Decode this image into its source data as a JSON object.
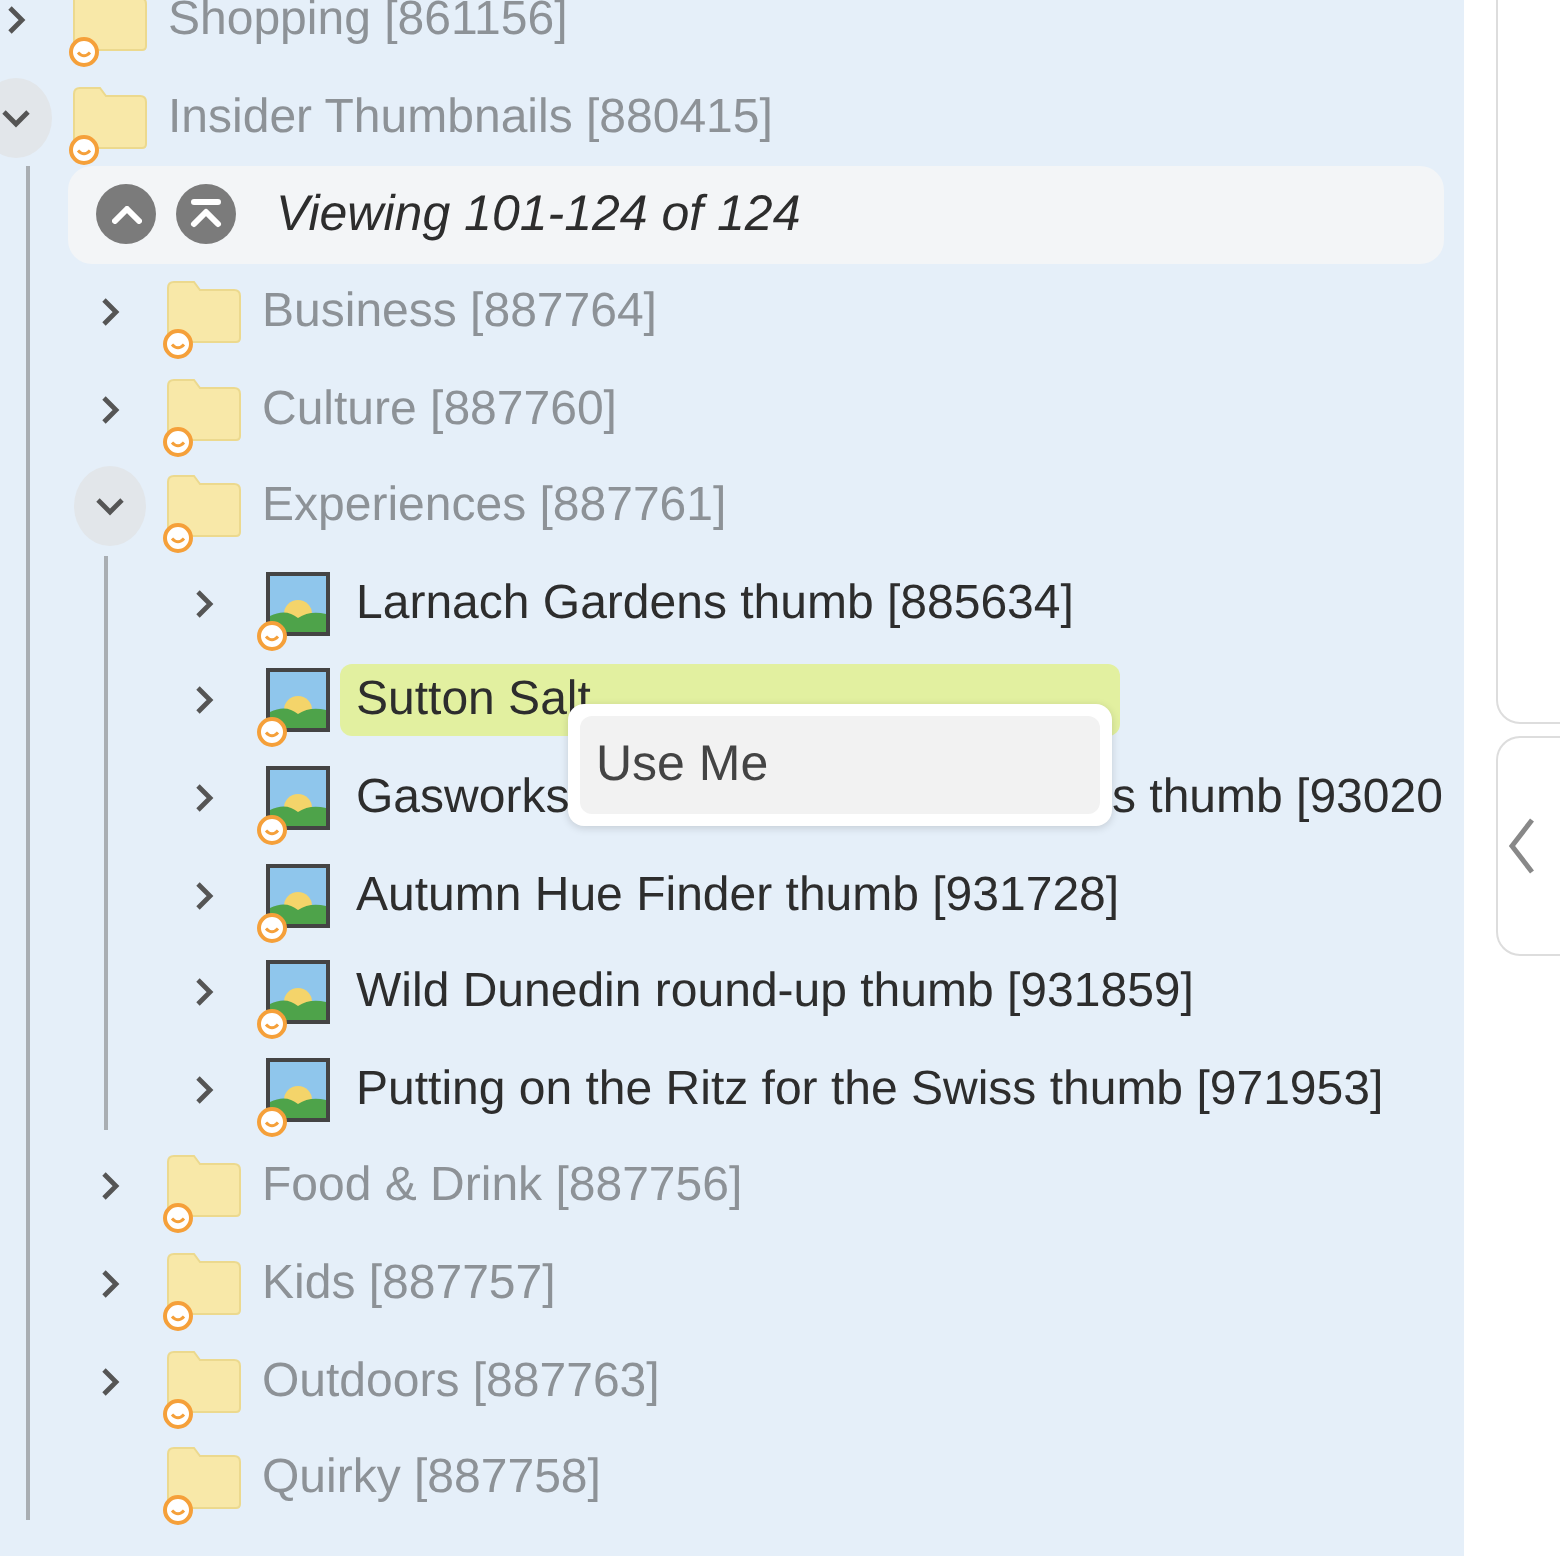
{
  "tree": [
    {
      "kind": "folder",
      "label": "Shopping [861156]",
      "has_children": true,
      "expanded": false
    },
    {
      "kind": "folder",
      "label": "Insider Thumbnails [880415]",
      "has_children": true,
      "expanded": true,
      "children": [
        {
          "kind": "pager",
          "text": "Viewing 101-124 of 124"
        },
        {
          "kind": "folder",
          "label": "Business [887764]",
          "has_children": true,
          "expanded": false
        },
        {
          "kind": "folder",
          "label": "Culture [887760]",
          "has_children": true,
          "expanded": false
        },
        {
          "kind": "folder",
          "label": "Experiences [887761]",
          "has_children": true,
          "expanded": true,
          "children": [
            {
              "kind": "image",
              "label": "Larnach Gardens thumb [885634]",
              "has_children": true,
              "expanded": false,
              "selected": false
            },
            {
              "kind": "image",
              "label": "Sutton Salt",
              "has_children": true,
              "expanded": false,
              "selected": true
            },
            {
              "kind": "image",
              "label": "Gasworks",
              "label_continued": "s thumb [93020",
              "has_children": true,
              "expanded": false,
              "selected": false
            },
            {
              "kind": "image",
              "label": "Autumn Hue Finder thumb [931728]",
              "has_children": true,
              "expanded": false,
              "selected": false
            },
            {
              "kind": "image",
              "label": "Wild Dunedin round-up thumb [931859]",
              "has_children": true,
              "expanded": false,
              "selected": false
            },
            {
              "kind": "image",
              "label": "Putting on the Ritz for the Swiss thumb [971953]",
              "has_children": true,
              "expanded": false,
              "selected": false
            }
          ]
        },
        {
          "kind": "folder",
          "label": "Food & Drink [887756]",
          "has_children": true,
          "expanded": false
        },
        {
          "kind": "folder",
          "label": "Kids [887757]",
          "has_children": true,
          "expanded": false
        },
        {
          "kind": "folder",
          "label": "Outdoors [887763]",
          "has_children": true,
          "expanded": false
        },
        {
          "kind": "folder",
          "label": "Quirky [887758]",
          "has_children": false
        }
      ]
    }
  ],
  "context_menu": {
    "items": [
      "Use Me"
    ]
  }
}
